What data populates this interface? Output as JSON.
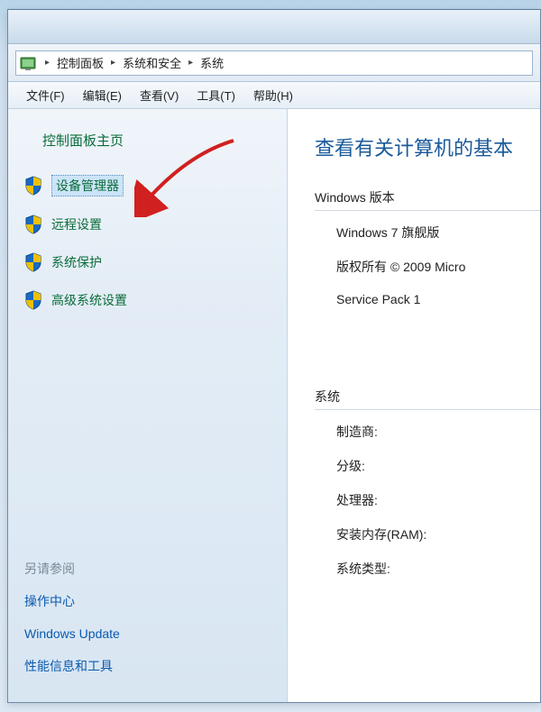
{
  "breadcrumb": {
    "items": [
      "控制面板",
      "系统和安全",
      "系统"
    ]
  },
  "menubar": {
    "file": "文件(F)",
    "edit": "编辑(E)",
    "view": "查看(V)",
    "tools": "工具(T)",
    "help": "帮助(H)"
  },
  "sidebar": {
    "title": "控制面板主页",
    "links": {
      "device_manager": "设备管理器",
      "remote_settings": "远程设置",
      "system_protection": "系统保护",
      "advanced_settings": "高级系统设置"
    },
    "see_also": {
      "title": "另请参阅",
      "action_center": "操作中心",
      "windows_update": "Windows Update",
      "perf_info": "性能信息和工具"
    }
  },
  "main": {
    "heading": "查看有关计算机的基本",
    "windows_edition": {
      "label": "Windows 版本",
      "edition": "Windows 7 旗舰版",
      "copyright": "版权所有 © 2009 Micro",
      "service_pack": "Service Pack 1"
    },
    "system": {
      "label": "系统",
      "manufacturer": "制造商:",
      "rating": "分级:",
      "processor": "处理器:",
      "ram": "安装内存(RAM):",
      "system_type": "系统类型:"
    }
  }
}
